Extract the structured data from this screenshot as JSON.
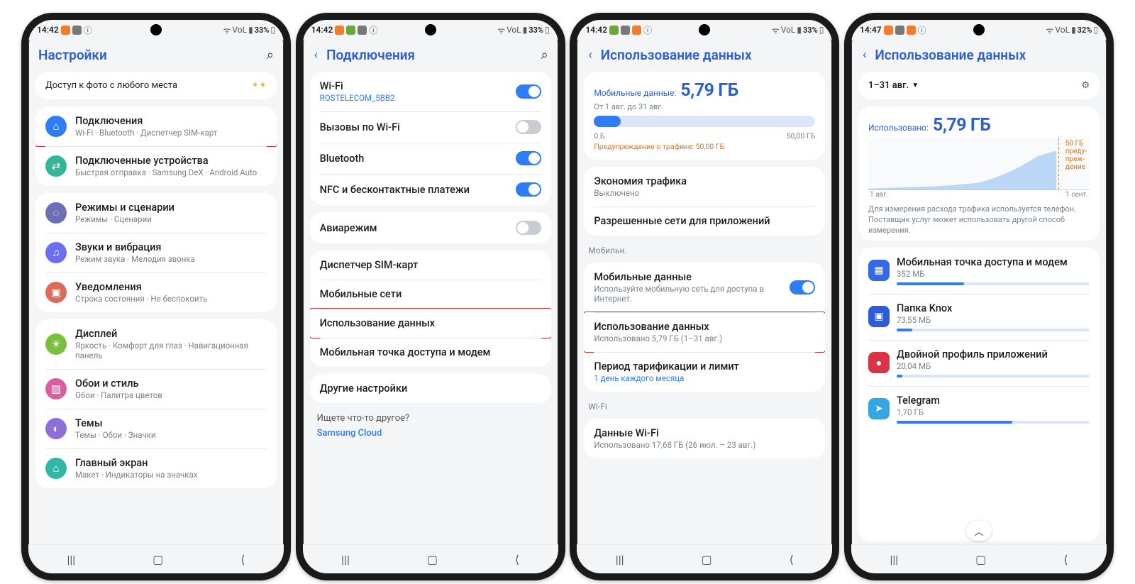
{
  "phones": [
    {
      "status": {
        "time": "14:42",
        "battery": "33%"
      },
      "header": {
        "title": "Настройки",
        "has_back": false
      },
      "promo": {
        "label": "Доступ к фото с любого места"
      },
      "groups": [
        [
          {
            "ico_bg": "#2e7cf6",
            "glyph": "⌂",
            "title": "Подключения",
            "sub": "Wi-Fi · Bluetooth · Диспетчер SIM-карт",
            "hl": true
          },
          {
            "ico_bg": "#2fb897",
            "glyph": "⇄",
            "title": "Подключенные устройства",
            "sub": "Быстрая отправка · Samsung DeX · Android Auto"
          }
        ],
        [
          {
            "ico_bg": "#6e6eb8",
            "glyph": "◌",
            "title": "Режимы и сценарии",
            "sub": "Режимы · Сценарии"
          },
          {
            "ico_bg": "#6a6ef0",
            "glyph": "♫",
            "title": "Звуки и вибрация",
            "sub": "Режим звука · Мелодия звонка"
          },
          {
            "ico_bg": "#e06a5a",
            "glyph": "▣",
            "title": "Уведомления",
            "sub": "Строка состояния · Не беспокоить"
          }
        ],
        [
          {
            "ico_bg": "#7bbf3e",
            "glyph": "☀",
            "title": "Дисплей",
            "sub": "Яркость · Комфорт для глаз · Навигационная панель"
          },
          {
            "ico_bg": "#d95fa0",
            "glyph": "▨",
            "title": "Обои и стиль",
            "sub": "Обои · Палитра цветов"
          },
          {
            "ico_bg": "#8e6ed9",
            "glyph": "◐",
            "title": "Темы",
            "sub": "Темы · Обои · Значки"
          },
          {
            "ico_bg": "#2fb8a8",
            "glyph": "⌂",
            "title": "Главный экран",
            "sub": "Макет · Индикаторы на значках"
          }
        ]
      ]
    },
    {
      "status": {
        "time": "14:42",
        "battery": "33%"
      },
      "header": {
        "title": "Подключения",
        "has_back": true
      },
      "rows": [
        {
          "title": "Wi-Fi",
          "sub_link": "ROSTELECOM_5BB2",
          "toggle": true,
          "on": true
        },
        {
          "title": "Вызовы по Wi-Fi",
          "toggle": true,
          "on": false
        },
        {
          "title": "Bluetooth",
          "toggle": true,
          "on": true
        },
        {
          "title": "NFC и бесконтактные платежи",
          "toggle": true,
          "on": true
        }
      ],
      "rows2": [
        {
          "title": "Авиарежим",
          "toggle": true,
          "on": false
        }
      ],
      "rows3": [
        {
          "title": "Диспетчер SIM-карт"
        },
        {
          "title": "Мобильные сети"
        },
        {
          "title": "Использование данных",
          "hl": true
        },
        {
          "title": "Мобильная точка доступа и модем"
        }
      ],
      "rows4": [
        {
          "title": "Другие настройки"
        }
      ],
      "search_more": {
        "label": "Ищете что-то другое?",
        "link": "Samsung Cloud"
      }
    },
    {
      "status": {
        "time": "14:42",
        "battery": "33%"
      },
      "header": {
        "title": "Использование данных",
        "has_back": true
      },
      "usage": {
        "label": "Мобильные данные:",
        "value": "5,79 ГБ",
        "period": "От 1 авг. до 31 авг.",
        "bar_min": "0 Б",
        "bar_max": "50,00 ГБ",
        "bar_pct": 12,
        "warn": "Предупреждение о трафике: 50,00 ГБ"
      },
      "rows": [
        {
          "title": "Экономия трафика",
          "sub": "Выключено"
        },
        {
          "title": "Разрешенные сети для приложений"
        }
      ],
      "section_mob": "Мобильн.",
      "rows_mob": [
        {
          "title": "Мобильные данные",
          "sub": "Используйте мобильную сеть для доступа в Интернет.",
          "toggle": true,
          "on": true
        },
        {
          "title": "Использование данных",
          "sub": "Использовано 5,79 ГБ (1–31 авг.)",
          "hl": true
        },
        {
          "title": "Период тарификации и лимит",
          "sub_link": "1 день каждого месяца"
        }
      ],
      "section_wifi": "Wi-Fi",
      "rows_wifi": [
        {
          "title": "Данные Wi-Fi",
          "sub": "Использовано 17,68 ГБ (26 июл. – 23 авг.)"
        }
      ]
    },
    {
      "status": {
        "time": "14:47",
        "battery": "32%"
      },
      "header": {
        "title": "Использование данных",
        "has_back": true
      },
      "top": {
        "period": "1–31 авг.",
        "used_label": "Использовано:",
        "used_value": "5,79 ГБ",
        "warn_right": "50 ГБ\nпреду-\nпреж-\nдение",
        "axis_left": "1 авг.",
        "axis_right": "1 сент.",
        "disclaimer": "Для измерения расхода трафика используется телефон. Поставщик услуг может использовать другой способ измерения."
      },
      "apps": [
        {
          "bg": "#3369e7",
          "glyph": "▦",
          "name": "Мобильная точка доступа и модем",
          "size": "352 МБ",
          "pct": 35
        },
        {
          "bg": "#2e5bd8",
          "glyph": "▣",
          "name": "Папка Knox",
          "size": "73,55 МБ",
          "pct": 8
        },
        {
          "bg": "#d9334a",
          "glyph": "●",
          "name": "Двойной профиль приложений",
          "size": "20,04 МБ",
          "pct": 3
        },
        {
          "bg": "#35a7e0",
          "glyph": "➤",
          "name": "Telegram",
          "size": "1,70 ГБ",
          "pct": 60
        }
      ],
      "chart_data": {
        "type": "area",
        "x_range": [
          "1 авг.",
          "1 сент."
        ],
        "approx_values": [
          0.1,
          0.1,
          0.15,
          0.2,
          0.2,
          0.3,
          0.3,
          0.4,
          0.5,
          0.6,
          0.9,
          1.3,
          1.8,
          2.4,
          3.0,
          3.5,
          4.0,
          4.5,
          5.0,
          5.3,
          5.6,
          5.79
        ],
        "warn_line_gb": 50,
        "used_gb": 5.79
      }
    }
  ],
  "icons": {
    "wifi_glyph": "⌂",
    "volte": "VoL",
    "lte": "LTE1"
  }
}
